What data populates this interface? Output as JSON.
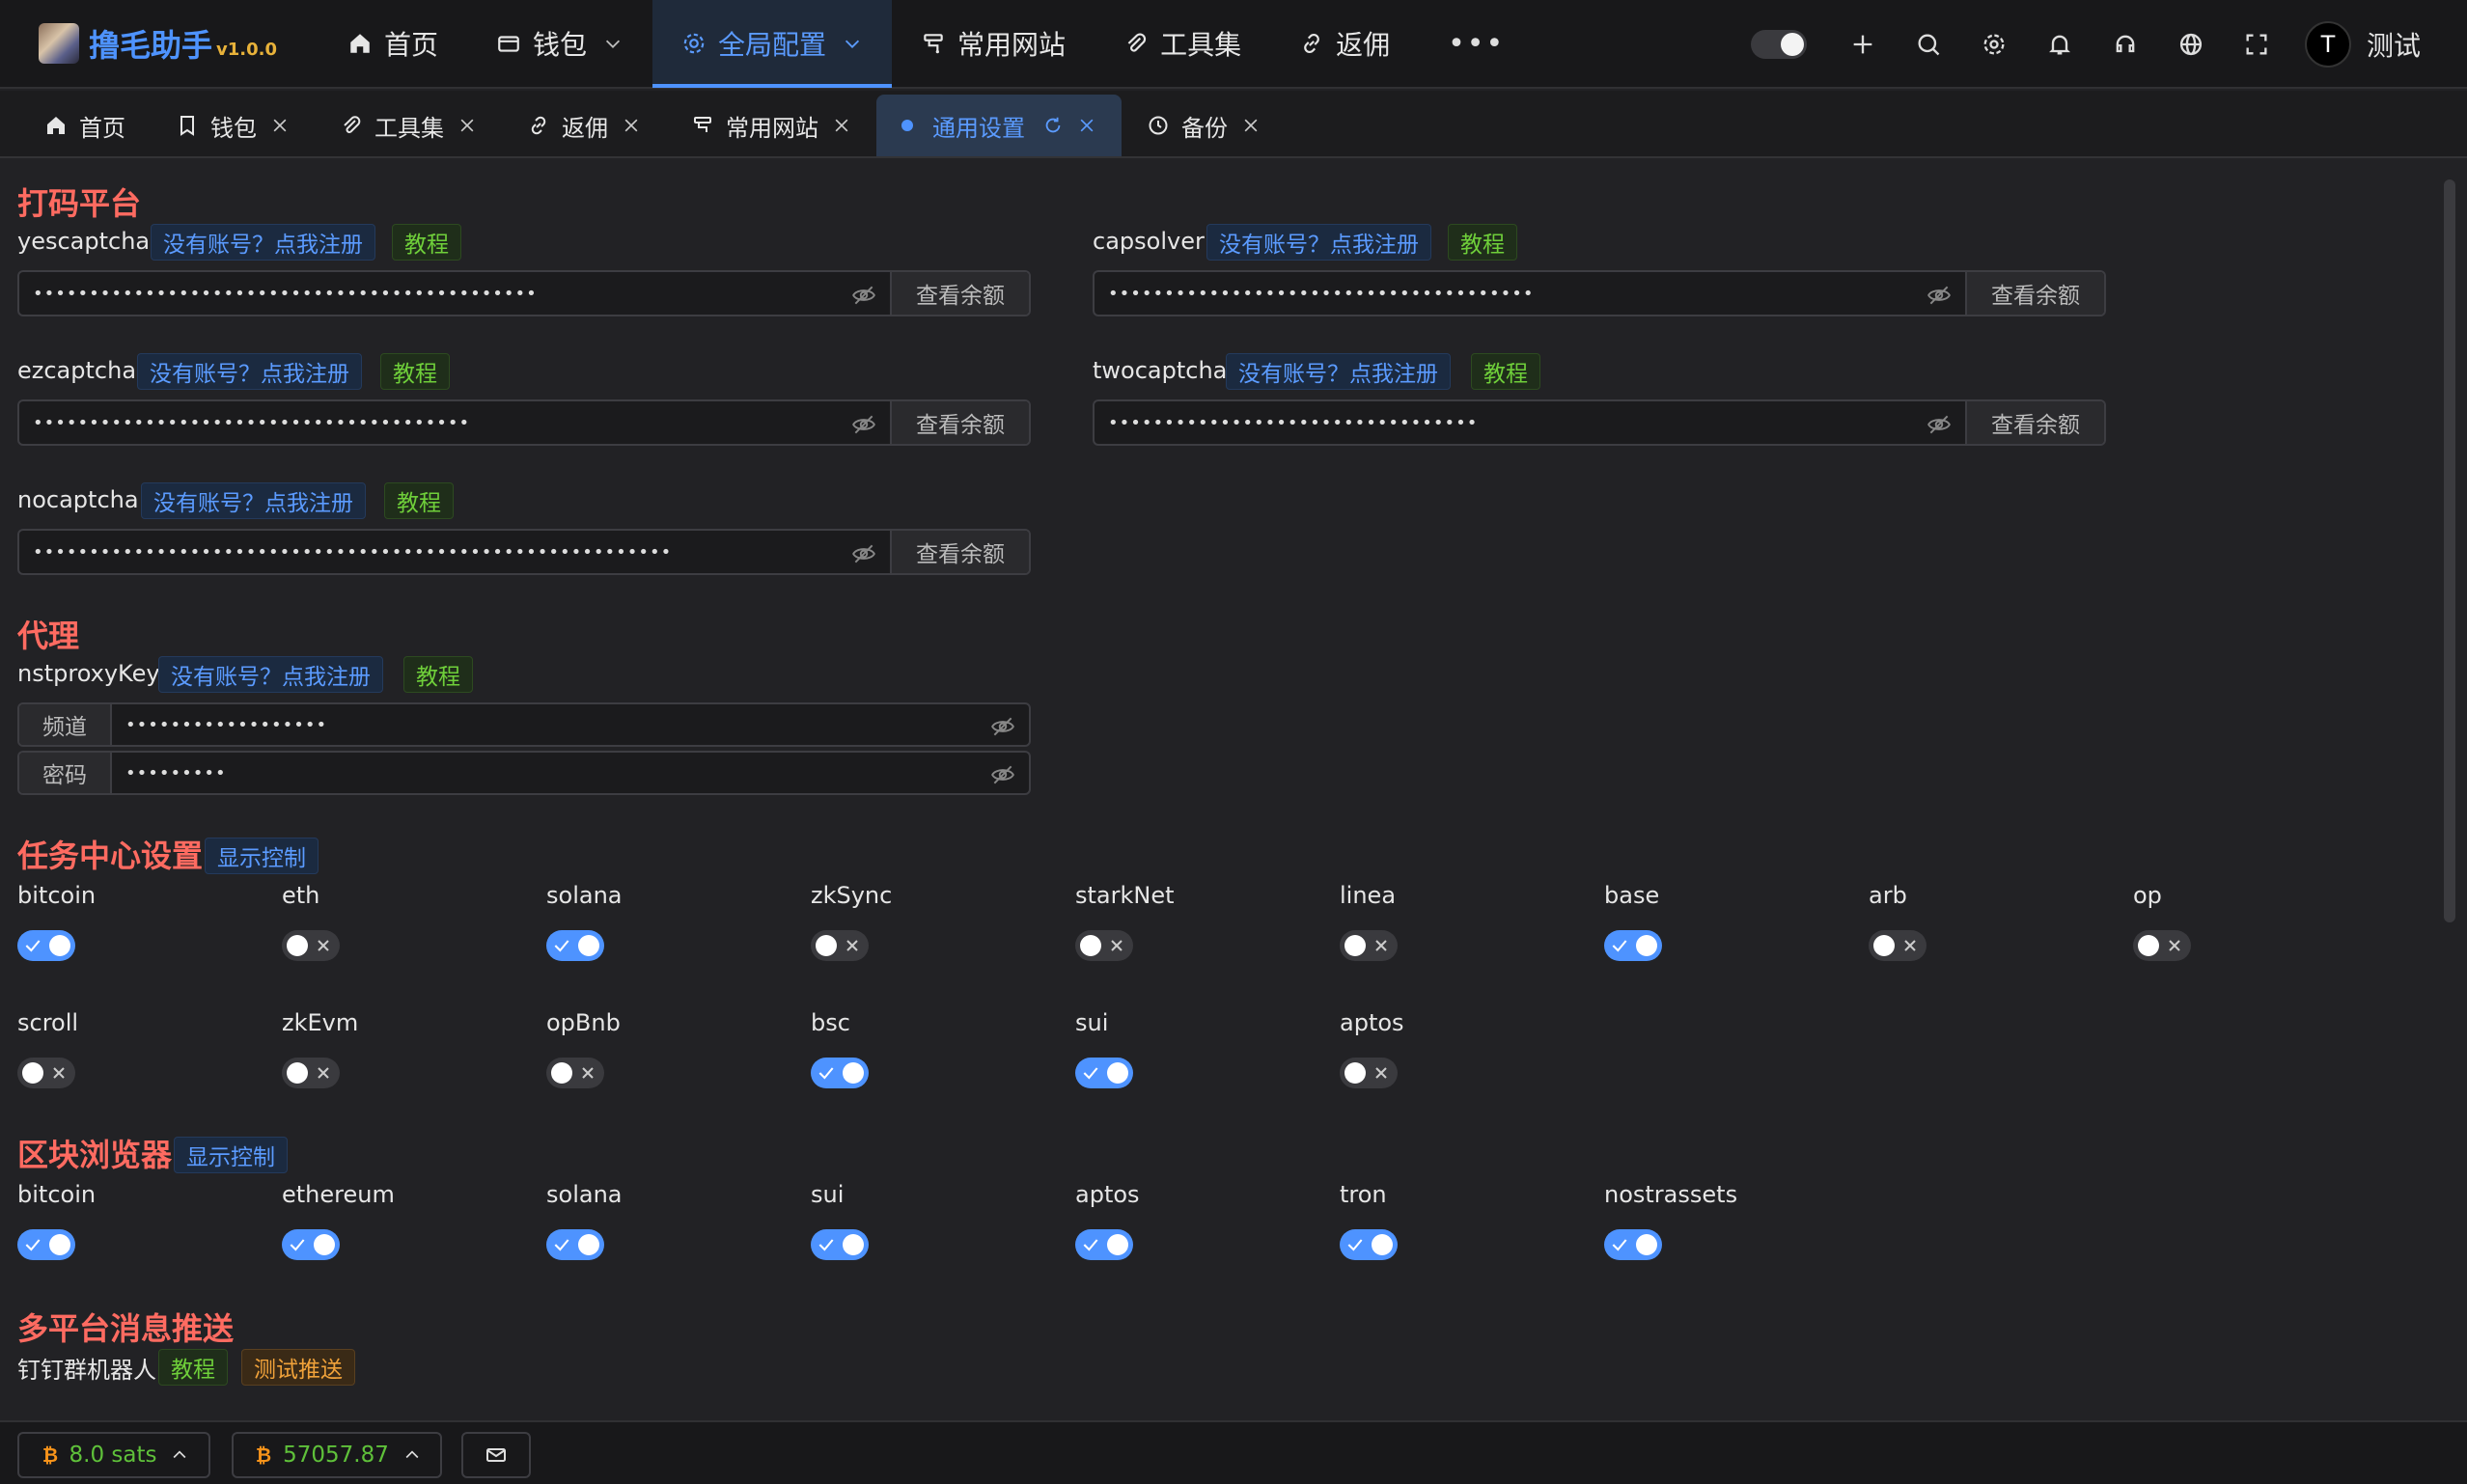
{
  "app": {
    "name": "撸毛助手",
    "version": "v1.0.0"
  },
  "nav": {
    "items": [
      {
        "label": "首页"
      },
      {
        "label": "钱包"
      },
      {
        "label": "全局配置"
      },
      {
        "label": "常用网站"
      },
      {
        "label": "工具集"
      },
      {
        "label": "返佣"
      }
    ],
    "more": "•••"
  },
  "user": {
    "initial": "T",
    "name": "测试"
  },
  "tabs": [
    {
      "label": "首页"
    },
    {
      "label": "钱包"
    },
    {
      "label": "工具集"
    },
    {
      "label": "返佣"
    },
    {
      "label": "常用网站"
    },
    {
      "label": "通用设置"
    },
    {
      "label": "备份"
    }
  ],
  "common": {
    "register_link": "没有账号？点我注册",
    "tutorial": "教程",
    "check_balance": "查看余额",
    "display_control": "显示控制",
    "test_push": "测试推送"
  },
  "captcha": {
    "title": "打码平台",
    "platforms": [
      {
        "name": "yescaptcha",
        "masked": "•••••••••••••••••••••••••••••••••••••••••••••"
      },
      {
        "name": "capsolver",
        "masked": "••••••••••••••••••••••••••••••••••••••"
      },
      {
        "name": "ezcaptcha",
        "masked": "•••••••••••••••••••••••••••••••••••••••"
      },
      {
        "name": "twocaptcha",
        "masked": "•••••••••••••••••••••••••••••••••"
      },
      {
        "name": "nocaptcha",
        "masked": "•••••••••••••••••••••••••••••••••••••••••••••••••••••••••"
      }
    ]
  },
  "proxy": {
    "title": "代理",
    "key_label": "nstproxyKey",
    "channel_label": "频道",
    "channel_masked": "••••••••••••••••••",
    "password_label": "密码",
    "password_masked": "•••••••••"
  },
  "task_center": {
    "title": "任务中心设置",
    "toggles": [
      {
        "name": "bitcoin",
        "on": true
      },
      {
        "name": "eth",
        "on": false
      },
      {
        "name": "solana",
        "on": true
      },
      {
        "name": "zkSync",
        "on": false
      },
      {
        "name": "starkNet",
        "on": false
      },
      {
        "name": "linea",
        "on": false
      },
      {
        "name": "base",
        "on": true
      },
      {
        "name": "arb",
        "on": false
      },
      {
        "name": "op",
        "on": false
      },
      {
        "name": "scroll",
        "on": false
      },
      {
        "name": "zkEvm",
        "on": false
      },
      {
        "name": "opBnb",
        "on": false
      },
      {
        "name": "bsc",
        "on": true
      },
      {
        "name": "sui",
        "on": true
      },
      {
        "name": "aptos",
        "on": false
      }
    ]
  },
  "explorer": {
    "title": "区块浏览器",
    "toggles": [
      {
        "name": "bitcoin",
        "on": true
      },
      {
        "name": "ethereum",
        "on": true
      },
      {
        "name": "solana",
        "on": true
      },
      {
        "name": "sui",
        "on": true
      },
      {
        "name": "aptos",
        "on": true
      },
      {
        "name": "tron",
        "on": true
      },
      {
        "name": "nostrassets",
        "on": true
      }
    ]
  },
  "push": {
    "title": "多平台消息推送",
    "dingtalk_label": "钉钉群机器人"
  },
  "footer": {
    "fee": "8.0 sats",
    "btc_price": "57057.87"
  },
  "colors": {
    "accent": "#4e93ff",
    "section_title": "#ff6b61",
    "tag_green": "#6fcf3a",
    "tag_orange": "#f0a23a",
    "footer_green": "#5fc13a"
  }
}
